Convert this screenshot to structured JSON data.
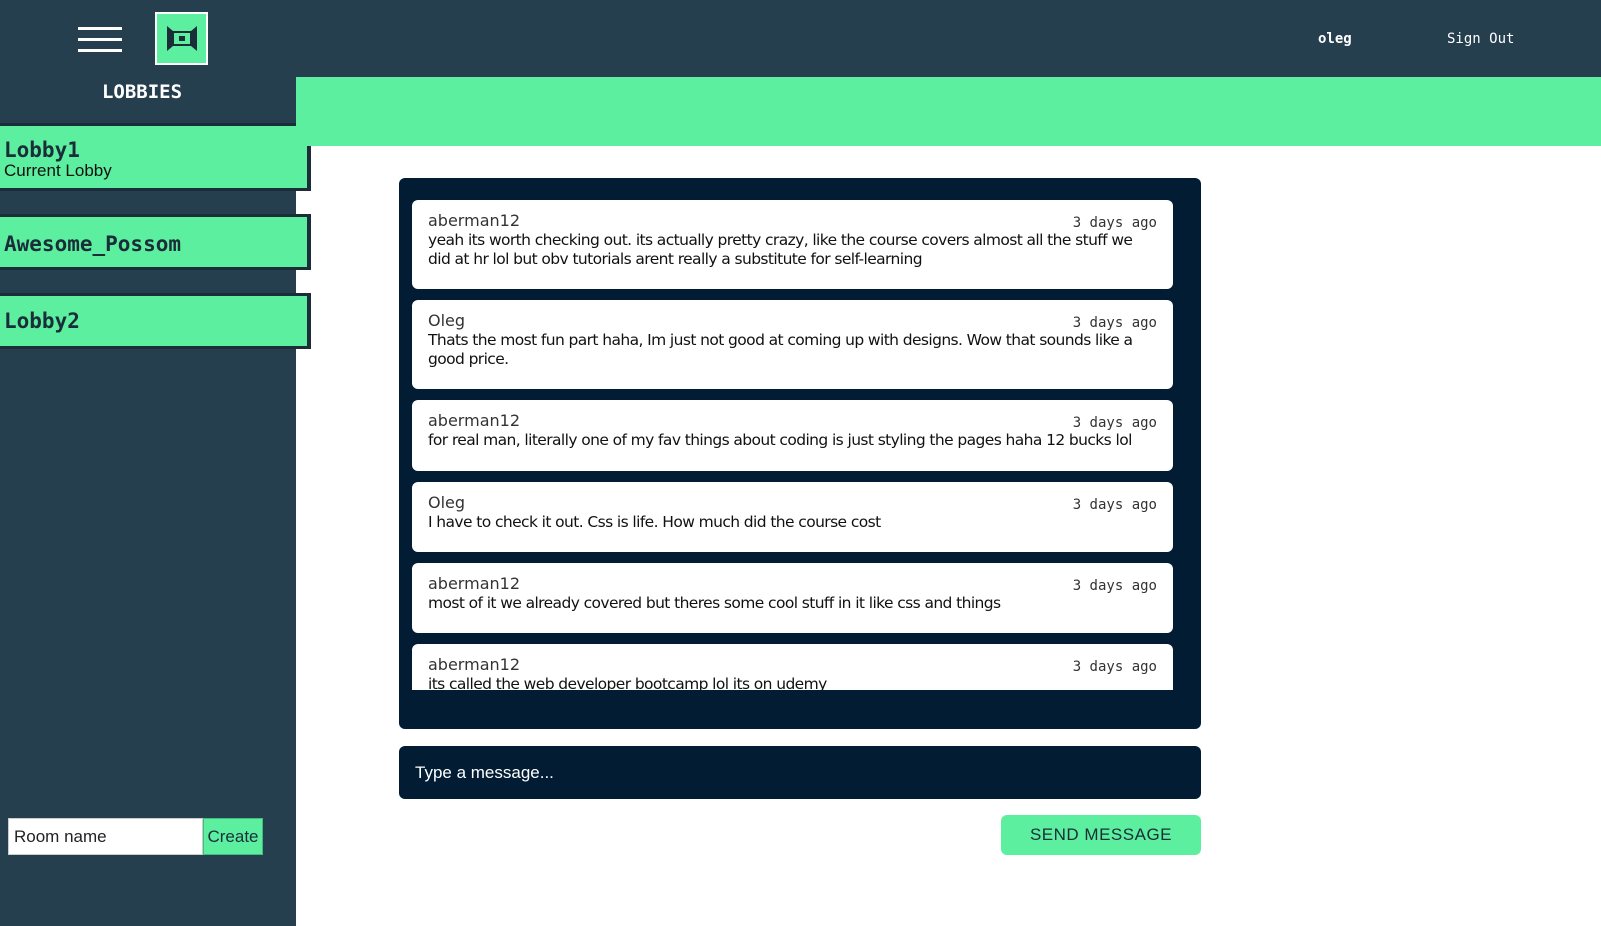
{
  "header": {
    "menu_icon": "hamburger-menu-icon",
    "logo_icon": "chat-logo-icon",
    "username": "oleg",
    "sign_out": "Sign Out"
  },
  "sidebar": {
    "title": "LOBBIES",
    "lobbies": [
      {
        "name": "Lobby1",
        "subtitle": "Current Lobby"
      },
      {
        "name": "Awesome_Possom",
        "subtitle": ""
      },
      {
        "name": "Lobby2",
        "subtitle": ""
      }
    ],
    "room_input_placeholder": "Room name",
    "create_label": "Create"
  },
  "chat": {
    "messages": [
      {
        "author": "aberman12",
        "time": "3 days ago",
        "text": "yeah its worth checking out. its actually pretty crazy, like the course covers almost all the stuff we did at hr lol but obv tutorials arent really a substitute for self-learning"
      },
      {
        "author": "Oleg",
        "time": "3 days ago",
        "text": "Thats the most fun part haha, Im just not good at coming up with designs. Wow that sounds like a good price."
      },
      {
        "author": "aberman12",
        "time": "3 days ago",
        "text": "for real man, literally one of my fav things about coding is just styling the pages haha 12 bucks lol"
      },
      {
        "author": "Oleg",
        "time": "3 days ago",
        "text": "I have to check it out. Css is life. How much did the course cost"
      },
      {
        "author": "aberman12",
        "time": "3 days ago",
        "text": "most of it we already covered but theres some cool stuff in it like css and things"
      },
      {
        "author": "aberman12",
        "time": "3 days ago",
        "text": "its called the web developer bootcamp lol its on udemy"
      }
    ],
    "input_placeholder": "Type a message...",
    "send_label": "SEND MESSAGE"
  },
  "colors": {
    "dark_navy": "#263f4f",
    "accent_green": "#5bef9f",
    "chat_bg": "#011c33"
  }
}
